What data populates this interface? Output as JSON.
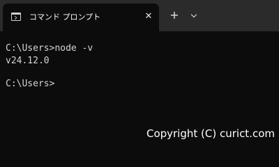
{
  "tab": {
    "title": "コマンド プロンプト",
    "icon": "command-prompt-icon",
    "close_icon": "close-icon",
    "close_glyph": "✕"
  },
  "titlebar": {
    "new_tab_glyph": "+",
    "new_tab_icon": "plus-icon",
    "dropdown_icon": "chevron-down-icon"
  },
  "terminal": {
    "lines": [
      "C:\\Users>node -v",
      "v24.12.0",
      "",
      "C:\\Users>"
    ]
  },
  "watermark": "Copyright (C) curict.com",
  "colors": {
    "titlebar_bg": "#2b2b2b",
    "terminal_bg": "#0c0c0c",
    "text": "#d4d4d4"
  }
}
